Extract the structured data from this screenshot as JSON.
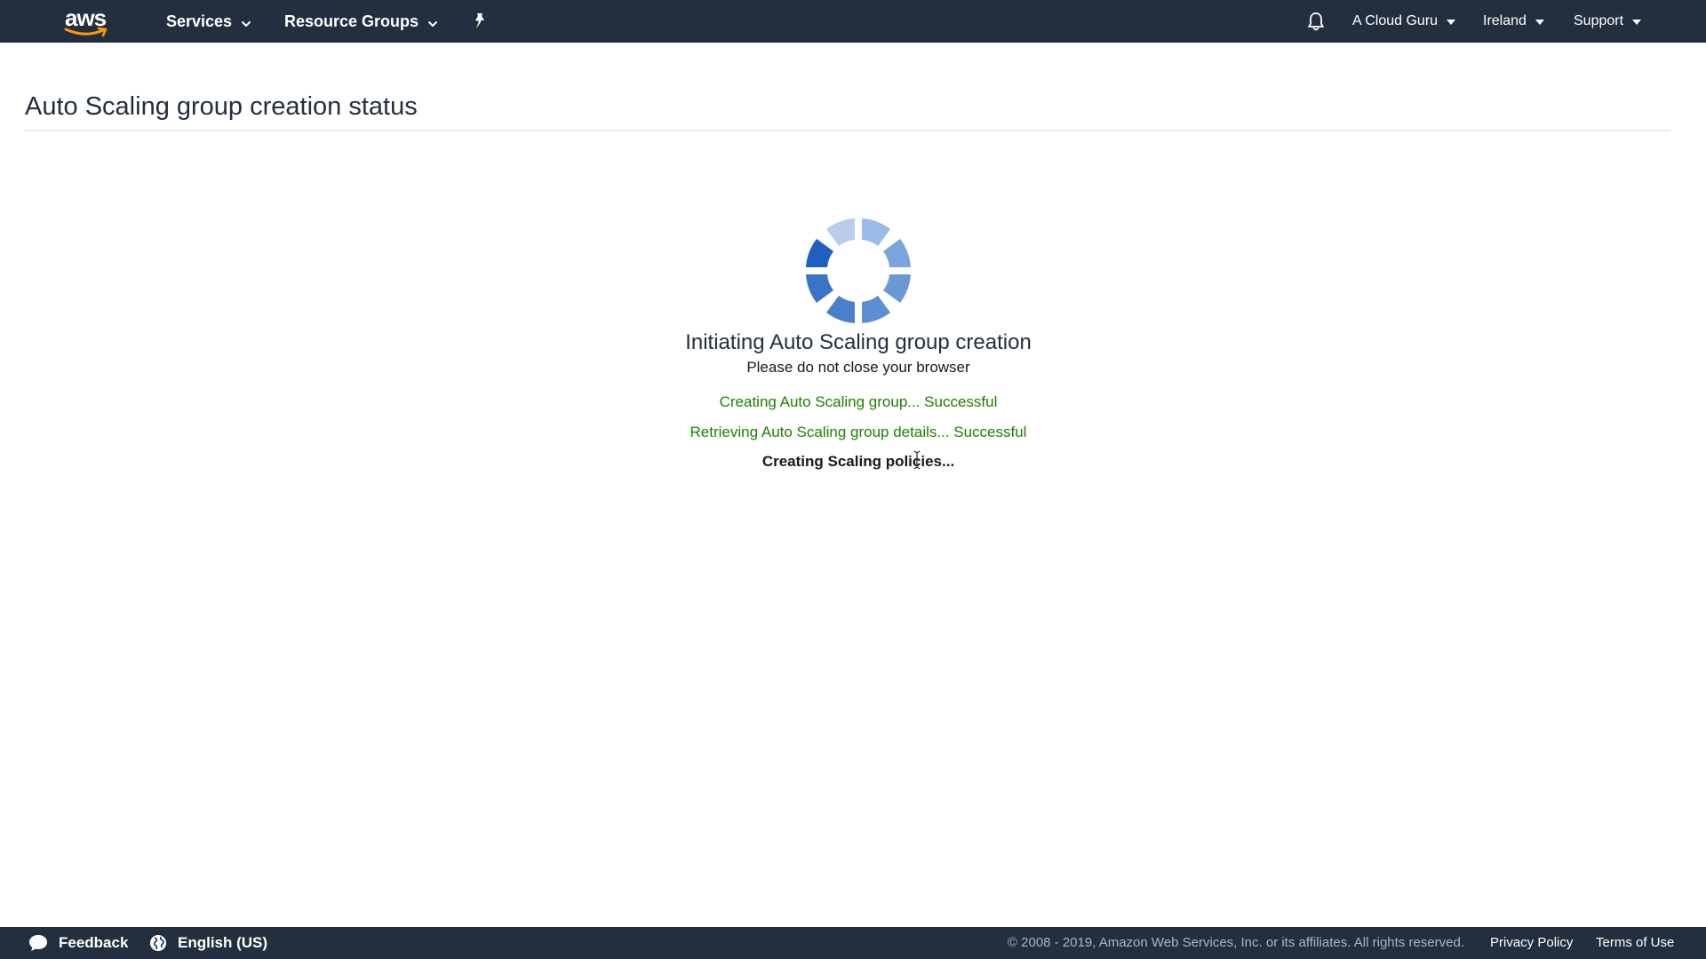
{
  "colors": {
    "nav_bg": "#232f3e",
    "aws_orange": "#ff9900",
    "success_green": "#1d8102",
    "spinner_blue": "#1f5fbf"
  },
  "topnav": {
    "logo_text": "aws",
    "services_label": "Services",
    "resource_groups_label": "Resource Groups",
    "pin_icon": "pin-icon",
    "bell_icon": "bell-icon",
    "account_label": "A Cloud Guru",
    "region_label": "Ireland",
    "support_label": "Support"
  },
  "page": {
    "title": "Auto Scaling group creation status"
  },
  "status": {
    "heading": "Initiating Auto Scaling group creation",
    "subheading": "Please do not close your browser",
    "steps": [
      {
        "text": "Creating Auto Scaling group... Successful",
        "state": "success"
      },
      {
        "text": "Retrieving Auto Scaling group details... Successful",
        "state": "success"
      },
      {
        "text": "Creating Scaling policies...",
        "state": "in-progress"
      }
    ]
  },
  "footer": {
    "feedback_label": "Feedback",
    "language_label": "English (US)",
    "copyright": "© 2008 - 2019, Amazon Web Services, Inc. or its affiliates. All rights reserved.",
    "privacy_label": "Privacy Policy",
    "terms_label": "Terms of Use"
  }
}
